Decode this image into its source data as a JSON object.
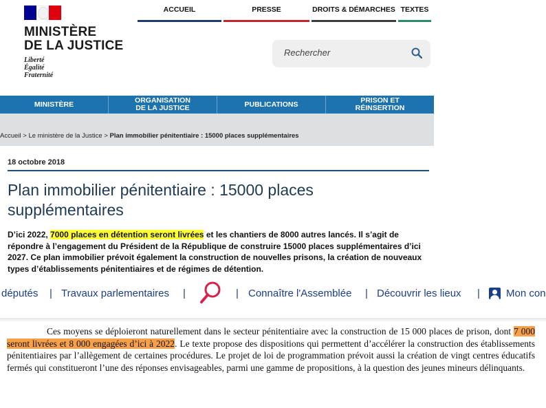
{
  "ministry": {
    "logo": {
      "name": "MINISTÈRE\nDE LA JUSTICE",
      "motto": "Liberté\nÉgalité\nFraternité",
      "flag_colors": [
        "#000091",
        "#ffffff",
        "#e1000f"
      ]
    },
    "top_nav": [
      "ACCUEIL",
      "PRESSE",
      "DROITS & DÉMARCHES",
      "TEXTES"
    ],
    "search": {
      "placeholder": "Rechercher",
      "icon": "search-icon"
    },
    "main_nav": [
      "MINISTÈRE",
      "ORGANISATION\nDE LA JUSTICE",
      "PUBLICATIONS",
      "PRISON ET\nRÉINSERTION"
    ],
    "breadcrumb": {
      "items": [
        "Accueil",
        "Le ministère de la Justice"
      ],
      "separator": ">",
      "current": "Plan immobilier pénitentiaire : 15000 places supplémentaires"
    },
    "article": {
      "date": "18 octobre 2018",
      "title": "Plan immobilier pénitentiaire : 15000 places supplémentaires",
      "lead_before": "D’ici 2022, ",
      "lead_highlight": "7000 places en détention seront livrées",
      "lead_after": " et les chantiers de 8000 autres lancés. Il s’agit de répondre à l’engagement du Président de la République de construire 15000 places supplémentaires d’ici 2027. Ce plan immobilier prévoit également la construction de nouvelles prisons, la création de nouveaux types d’établissements pénitentiaires et de régimes de détention."
    },
    "colors": {
      "nav_blue": "#1d73b0",
      "title_color": "#1f3a52",
      "highlight": "#ffff2e"
    }
  },
  "assemblee_menu": {
    "items": [
      "députés",
      "Travaux parlementaires",
      "Connaître l'Assemblée",
      "Découvrir les lieux",
      "Mon con"
    ],
    "separator": "|",
    "icons": [
      "magnifier-icon",
      "user-icon"
    ],
    "link_color": "#1b3d8a"
  },
  "legal_text": {
    "before": "Ces moyens se déploieront naturellement dans le secteur pénitentiaire avec la construction de 15 000 places de prison, dont ",
    "highlight": "7 000 seront livrées et 8 000 engagées d’ici à 2022",
    "after": ". Le texte propose des dispositions qui permettent d’accélérer la construction des établissements pénitentiaires par l’allègement de certaines procédures. Le projet de loi de programmation prévoit aussi la création de vingt centres éducatifs fermés qui constitueront l’une des réponses envisageables, parmi une gamme de propositions, à la question des jeunes mineurs délinquants.",
    "highlight_color": "#f7a04b"
  }
}
